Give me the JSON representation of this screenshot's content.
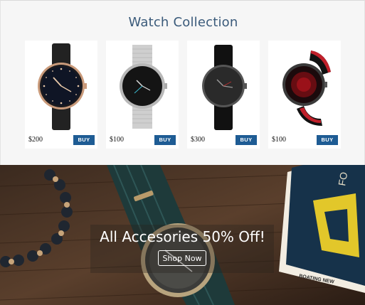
{
  "section_title": "Watch Collection",
  "products": [
    {
      "name": "black-rose-gold-watch",
      "price": "$200",
      "buy_label": "BUY"
    },
    {
      "name": "silver-mesh-smartwatch",
      "price": "$100",
      "buy_label": "BUY"
    },
    {
      "name": "gunmetal-leather-watch",
      "price": "$300",
      "buy_label": "BUY"
    },
    {
      "name": "red-sport-smartwatch",
      "price": "$100",
      "buy_label": "BUY"
    }
  ],
  "banner": {
    "headline": "All Accesories 50% Off!",
    "cta_label": "Shop Now",
    "book_letters": "FO",
    "book_caption": "BOATING NEW"
  },
  "colors": {
    "accent": "#1e5c94",
    "title": "#3a5a7a"
  }
}
